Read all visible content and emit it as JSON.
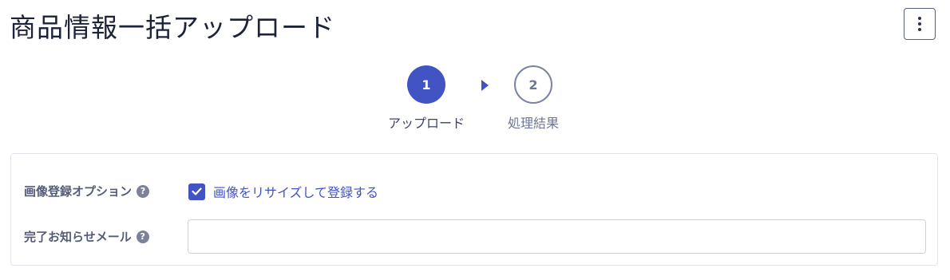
{
  "header": {
    "title": "商品情報一括アップロード",
    "menu_icon": "kebab-menu-icon"
  },
  "stepper": {
    "steps": [
      {
        "number": "1",
        "label": "アップロード",
        "state": "active"
      },
      {
        "number": "2",
        "label": "処理結果",
        "state": "inactive"
      }
    ],
    "active_color": "#4253c4",
    "inactive_color": "#7c84a3"
  },
  "options": {
    "image_option": {
      "label": "画像登録オプション",
      "help_glyph": "?",
      "checkbox_label": "画像をリサイズして登録する",
      "checked": true
    },
    "email": {
      "label": "完了お知らせメール",
      "help_glyph": "?",
      "value": "",
      "placeholder": ""
    }
  }
}
